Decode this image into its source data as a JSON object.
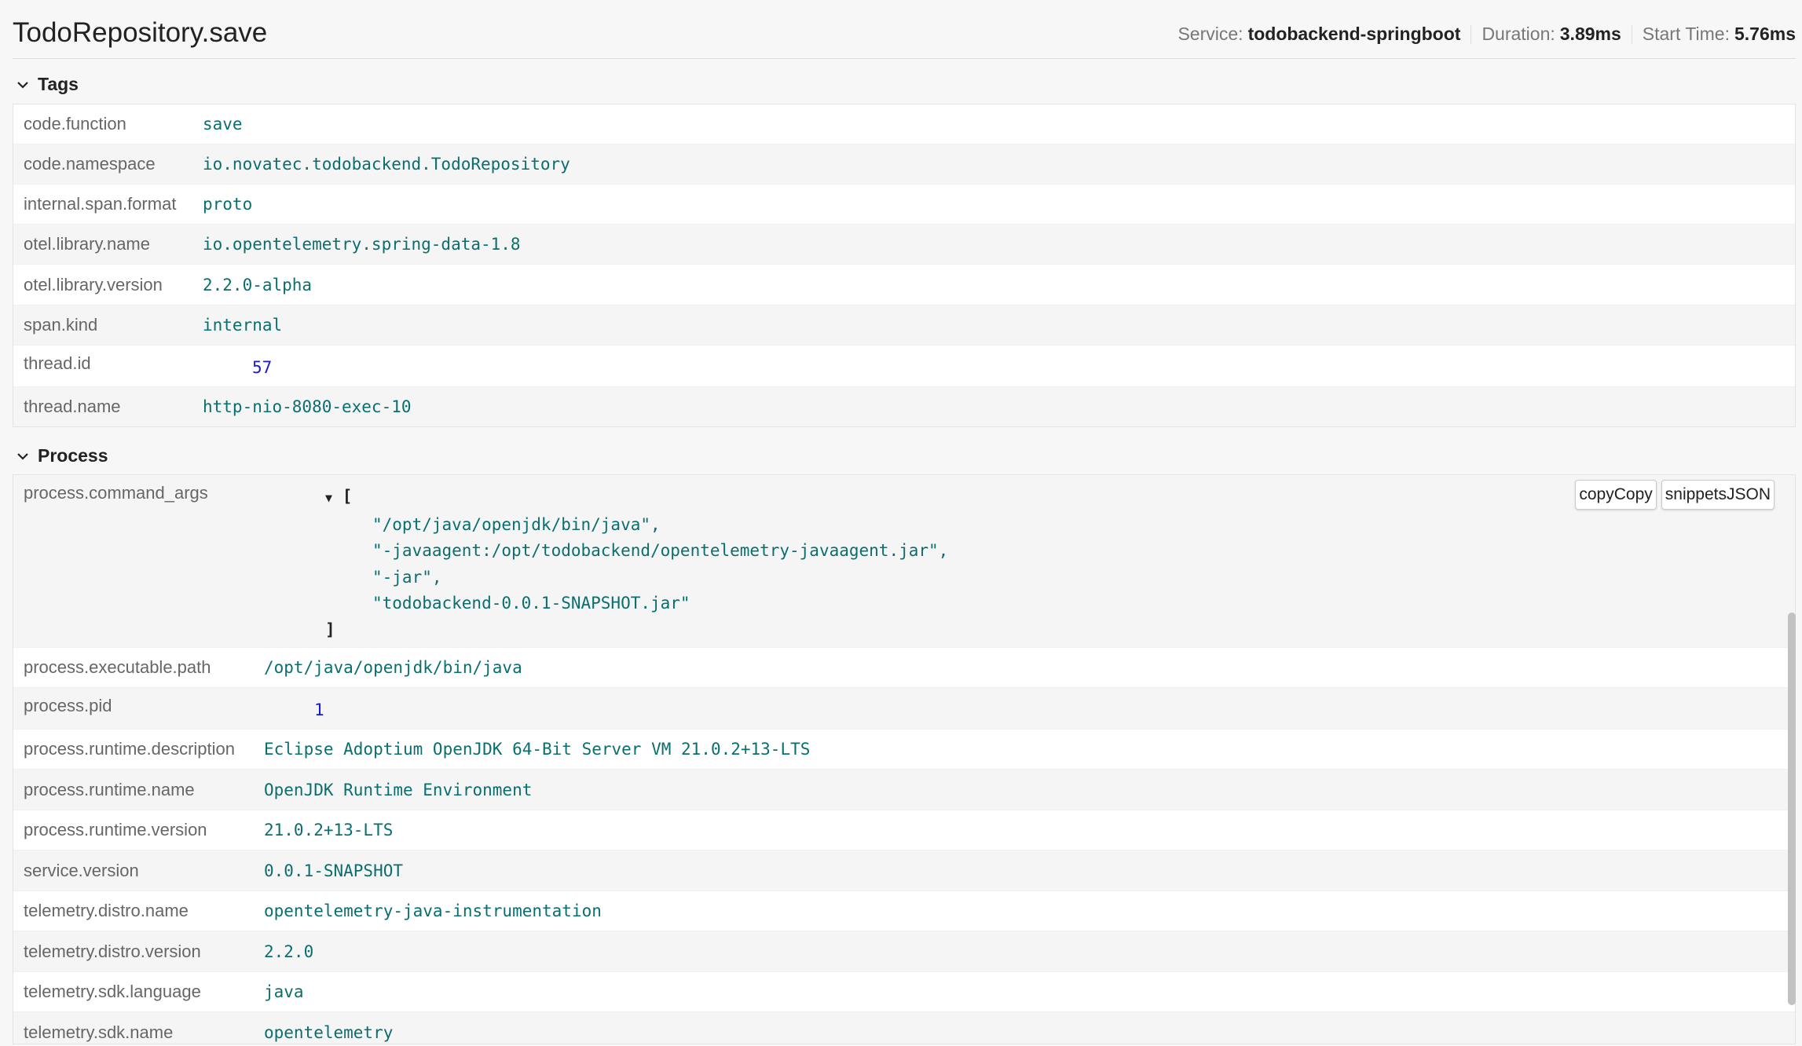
{
  "header": {
    "title": "TodoRepository.save",
    "service_label": "Service:",
    "service_value": "todobackend-springboot",
    "duration_label": "Duration:",
    "duration_value": "3.89ms",
    "start_label": "Start Time:",
    "start_value": "5.76ms"
  },
  "tags": {
    "heading": "Tags",
    "rows": [
      {
        "key": "code.function",
        "value": "save"
      },
      {
        "key": "code.namespace",
        "value": "io.novatec.todobackend.TodoRepository"
      },
      {
        "key": "internal.span.format",
        "value": "proto"
      },
      {
        "key": "otel.library.name",
        "value": "io.opentelemetry.spring-data-1.8"
      },
      {
        "key": "otel.library.version",
        "value": "2.2.0-alpha"
      },
      {
        "key": "span.kind",
        "value": "internal"
      },
      {
        "key": "thread.id",
        "value": "57"
      },
      {
        "key": "thread.name",
        "value": "http-nio-8080-exec-10"
      }
    ]
  },
  "process": {
    "heading": "Process",
    "command_args_key": "process.command_args",
    "toggle": "▼",
    "open_bracket": "[",
    "close_bracket": "]",
    "command_args": [
      "\"/opt/java/openjdk/bin/java\",",
      "\"-javaagent:/opt/todobackend/opentelemetry-javaagent.jar\",",
      "\"-jar\",",
      "\"todobackend-0.0.1-SNAPSHOT.jar\""
    ],
    "copy_button": "copyCopy",
    "json_button": "snippetsJSON",
    "rows": [
      {
        "key": "process.executable.path",
        "value": "/opt/java/openjdk/bin/java"
      },
      {
        "key": "process.pid",
        "value": "1"
      },
      {
        "key": "process.runtime.description",
        "value": "Eclipse Adoptium OpenJDK 64-Bit Server VM 21.0.2+13-LTS"
      },
      {
        "key": "process.runtime.name",
        "value": "OpenJDK Runtime Environment"
      },
      {
        "key": "process.runtime.version",
        "value": "21.0.2+13-LTS"
      },
      {
        "key": "service.version",
        "value": "0.0.1-SNAPSHOT"
      },
      {
        "key": "telemetry.distro.name",
        "value": "opentelemetry-java-instrumentation"
      },
      {
        "key": "telemetry.distro.version",
        "value": "2.2.0"
      },
      {
        "key": "telemetry.sdk.language",
        "value": "java"
      },
      {
        "key": "telemetry.sdk.name",
        "value": "opentelemetry"
      }
    ]
  }
}
